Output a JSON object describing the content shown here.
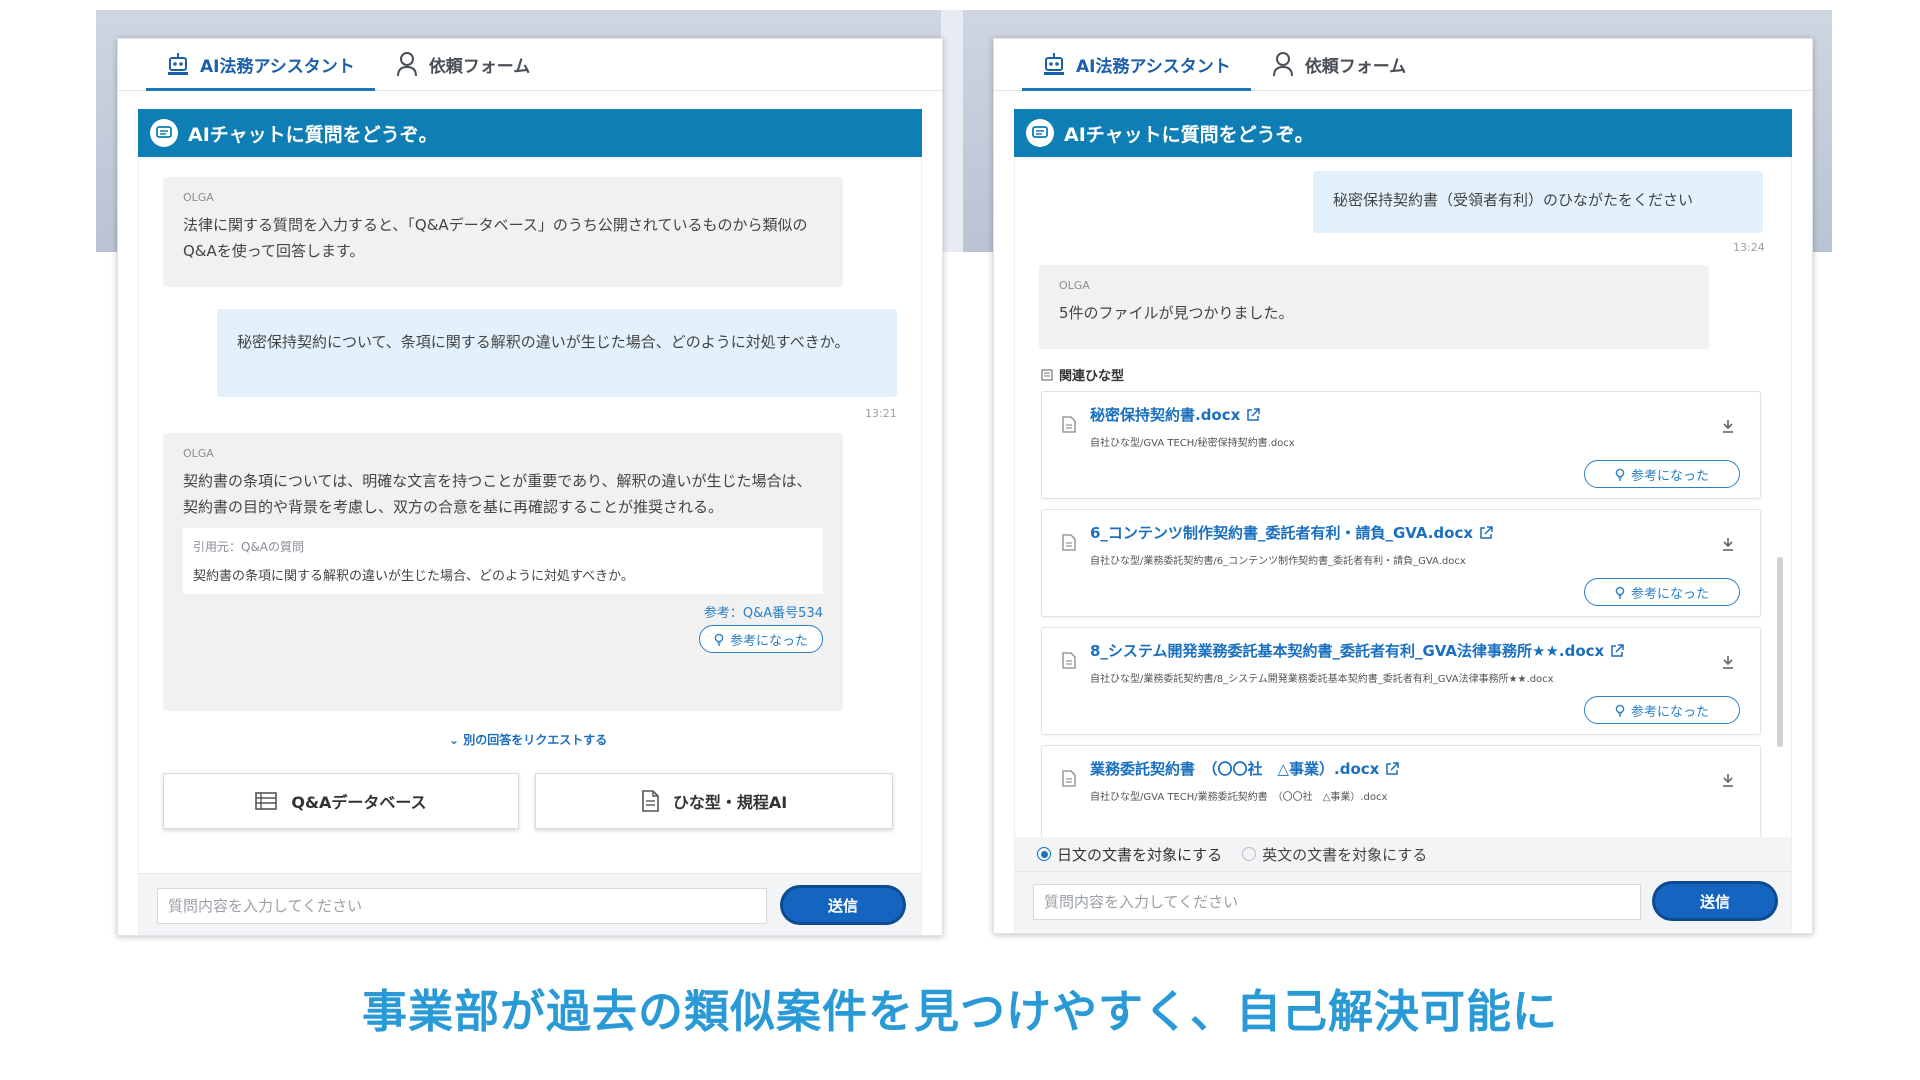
{
  "tabs": {
    "assistant": "AI法務アシスタント",
    "request": "依頼フォーム"
  },
  "chat_header": "AIチャットに質問をどうぞ。",
  "left": {
    "bot_intro": {
      "who": "OLGA",
      "text": "法律に関する質問を入力すると、「Q&Aデータベース」のうち公開されているものから類似のQ&Aを使って回答します。"
    },
    "user_msg": {
      "text": "秘密保持契約について、条項に関する解釈の違いが生じた場合、どのように対処すべきか。",
      "time": "13:21"
    },
    "bot_answer": {
      "who": "OLGA",
      "text": "契約書の条項については、明確な文言を持つことが重要であり、解釈の違いが生じた場合は、契約書の目的や背景を考慮し、双方の合意を基に再確認することが推奨される。",
      "quote_label": "引用元：Q&Aの質問",
      "quote_text": "契約書の条項に関する解釈の違いが生じた場合、どのように対処すべきか。",
      "ref": "参考：Q&A番号534",
      "helpful": "参考になった"
    },
    "request_link": "別の回答をリクエストする",
    "btn_qa": "Q&Aデータベース",
    "btn_template": "ひな型・規程AI",
    "input_placeholder": "質問内容を入力してください",
    "send": "送信"
  },
  "right": {
    "user_msg": {
      "text": "秘密保持契約書（受領者有利）のひながたをください",
      "time": "13:24"
    },
    "bot_msg": {
      "who": "OLGA",
      "text": "5件のファイルが見つかりました。"
    },
    "section_label": "関連ひな型",
    "files": [
      {
        "name": "秘密保持契約書.docx",
        "path": "自社ひな型/GVA TECH/秘密保持契約書.docx",
        "helpful": "参考になった"
      },
      {
        "name": "6_コンテンツ制作契約書_委託者有利・請負_GVA.docx",
        "path": "自社ひな型/業務委託契約書/6_コンテンツ制作契約書_委託者有利・請負_GVA.docx",
        "helpful": "参考になった"
      },
      {
        "name": "8_システム開発業務委託基本契約書_委託者有利_GVA法律事務所★★.docx",
        "path": "自社ひな型/業務委託契約書/8_システム開発業務委託基本契約書_委託者有利_GVA法律事務所★★.docx",
        "helpful": "参考になった"
      },
      {
        "name": "業務委託契約書　（〇〇社　△事業）.docx",
        "path": "自社ひな型/GVA TECH/業務委託契約書　（〇〇社　△事業）.docx"
      }
    ],
    "radio_ja": "日文の文書を対象にする",
    "radio_en": "英文の文書を対象にする",
    "input_placeholder": "質問内容を入力してください",
    "send": "送信"
  },
  "caption": "事業部が過去の類似案件を見つけやすく、自己解決可能に",
  "colors": {
    "header_blue": "#0f7eb4",
    "accent_blue": "#1a6fbf",
    "caption_blue": "#2a9ad6",
    "user_bubble": "#e3f1fc"
  }
}
